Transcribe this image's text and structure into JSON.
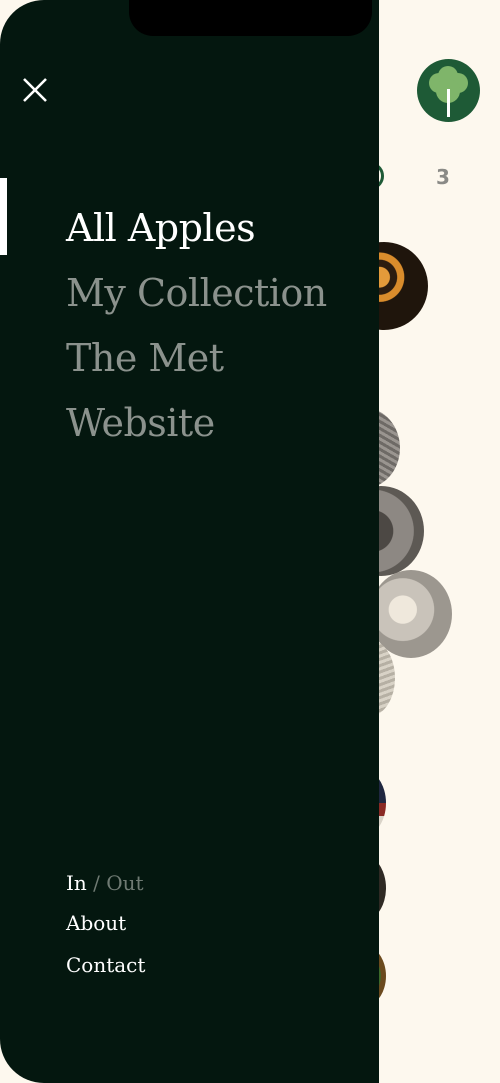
{
  "drawer": {
    "close_icon": "close-icon",
    "nav_items": [
      {
        "label": "All Apples",
        "active": true
      },
      {
        "label": "My Collection",
        "active": false
      },
      {
        "label": "The Met",
        "active": false
      },
      {
        "label": "Website",
        "active": false
      }
    ],
    "toggle": {
      "in_label": "In",
      "separator": "/",
      "out_label": "Out"
    },
    "footer_links": [
      {
        "label": "About"
      },
      {
        "label": "Contact"
      }
    ]
  },
  "background": {
    "logo_icon": "tree-icon",
    "page_number": "3"
  },
  "colors": {
    "drawer_bg": "#04170f",
    "page_bg": "#fdf8ee",
    "brand_green": "#1e5a36",
    "nav_inactive": "#8b928d",
    "nav_active": "#ffffff"
  }
}
